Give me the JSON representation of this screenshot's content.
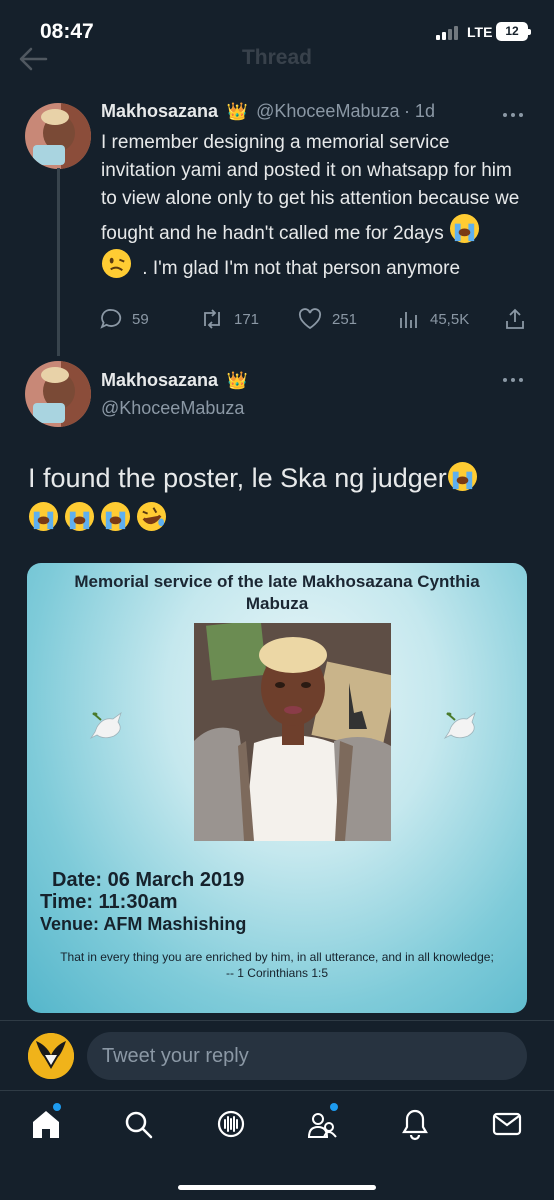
{
  "status_bar": {
    "time": "08:47",
    "network": "LTE",
    "battery": "12"
  },
  "header": {
    "title": "Thread"
  },
  "post1": {
    "name": "Makhosazana",
    "handle": "@KhoceeMabuza",
    "time": "· 1d",
    "text": "I remember designing a memorial service invitation yami and posted it on whatsapp for him to view alone only to get his attention because we fought and he hadn't called me for 2days",
    "text_tail": ". I'm glad I'm not that person anymore",
    "replies": "59",
    "retweets": "171",
    "likes": "251",
    "views": "45,5K"
  },
  "post2": {
    "name": "Makhosazana",
    "handle": "@KhoceeMabuza",
    "text": "I found the poster, le Ska ng judger"
  },
  "poster": {
    "title": "Memorial service of the late Makhosazana Cynthia Mabuza",
    "date": "Date: 06 March 2019",
    "time": "Time: 11:30am",
    "venue": "Venue: AFM Mashishing",
    "verse": "That in every thing you are enriched by him, in all utterance, and in all knowledge;",
    "verse_ref": "-- 1 Corinthians 1:5"
  },
  "reply": {
    "placeholder": "Tweet your reply"
  },
  "colors": {
    "background": "#15202b",
    "accent": "#1d9bf0",
    "muted": "#8b98a5"
  },
  "tabs": [
    "home-icon",
    "search-icon",
    "spaces-icon",
    "communities-icon",
    "notifications-icon",
    "messages-icon"
  ]
}
